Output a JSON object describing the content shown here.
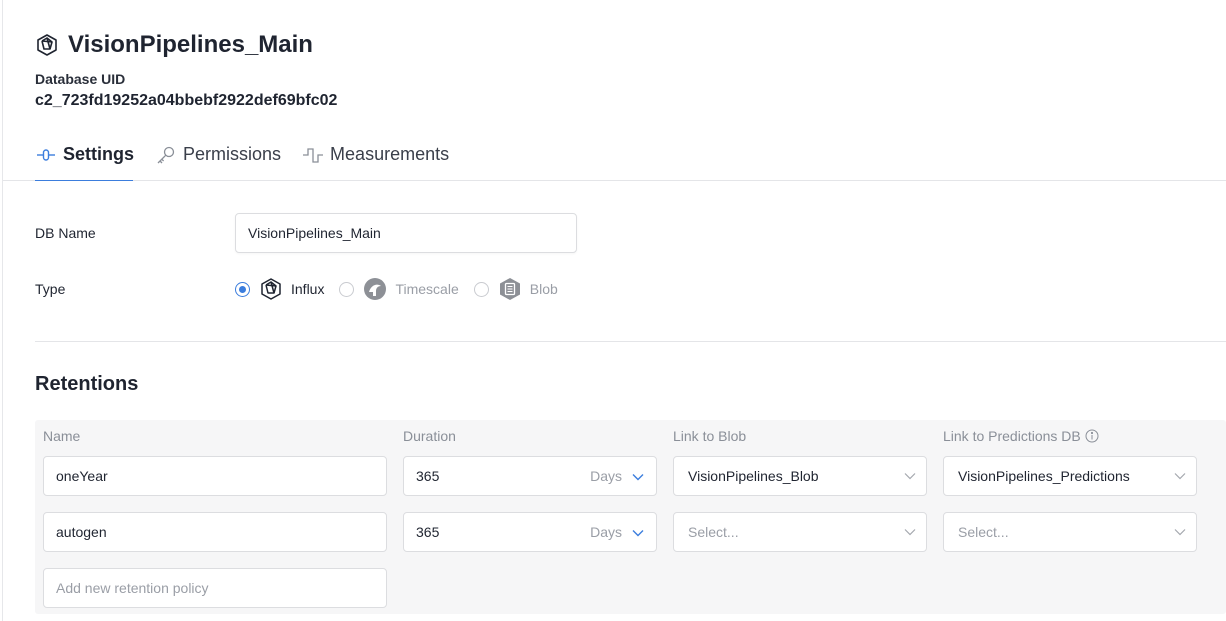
{
  "header": {
    "title": "VisionPipelines_Main",
    "title_icon": "influx-hexagon-icon",
    "uid_label": "Database UID",
    "uid_value": "c2_723fd19252a04bbebf2922def69bfc02"
  },
  "tabs": [
    {
      "label": "Settings",
      "icon": "settings-slider-icon",
      "active": true
    },
    {
      "label": "Permissions",
      "icon": "key-icon",
      "active": false
    },
    {
      "label": "Measurements",
      "icon": "signal-wave-icon",
      "active": false
    }
  ],
  "settings": {
    "db_name_label": "DB Name",
    "db_name_value": "VisionPipelines_Main",
    "type_label": "Type",
    "types": [
      {
        "label": "Influx",
        "selected": true,
        "enabled": true
      },
      {
        "label": "Timescale",
        "selected": false,
        "enabled": false
      },
      {
        "label": "Blob",
        "selected": false,
        "enabled": false
      }
    ]
  },
  "retentions": {
    "title": "Retentions",
    "columns": {
      "name": "Name",
      "duration": "Duration",
      "link_blob": "Link to Blob",
      "link_predictions": "Link to Predictions DB"
    },
    "rows": [
      {
        "name": "oneYear",
        "duration": "365",
        "unit": "Days",
        "link_blob": "VisionPipelines_Blob",
        "link_predictions": "VisionPipelines_Predictions"
      },
      {
        "name": "autogen",
        "duration": "365",
        "unit": "Days",
        "link_blob": "Select...",
        "link_predictions": "Select..."
      }
    ],
    "new_placeholder": "Add new retention policy"
  },
  "colors": {
    "accent": "#3b7ddd",
    "text": "#1f2430",
    "muted": "#9a9ea6",
    "panel_bg": "#f6f6f7"
  }
}
